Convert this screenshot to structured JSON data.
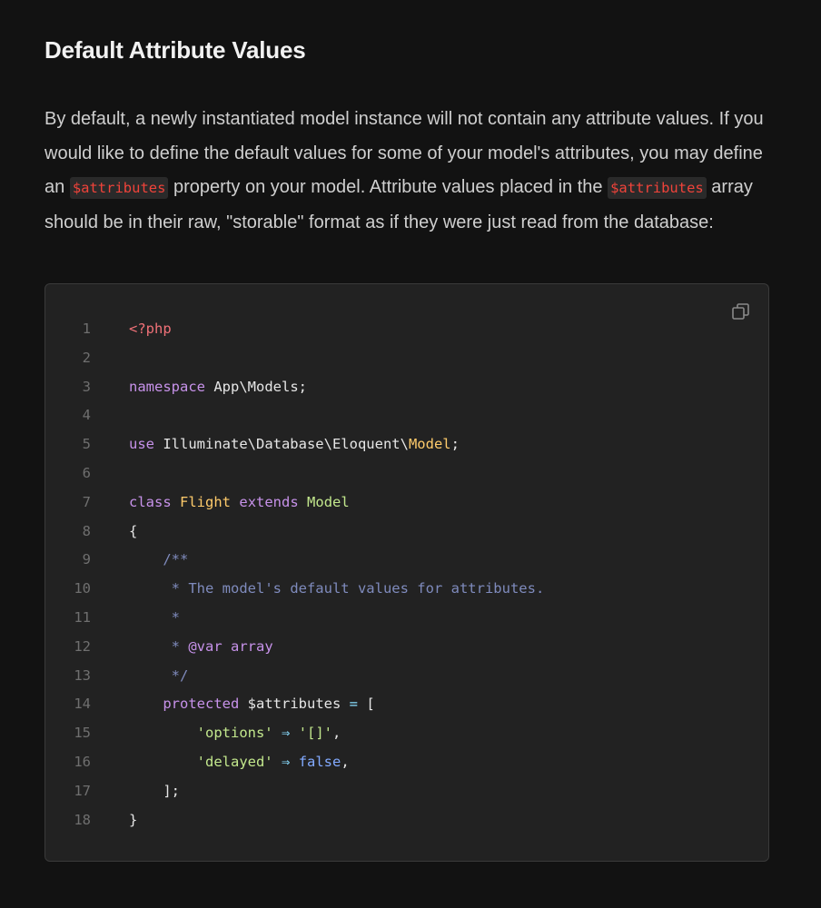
{
  "heading": "Default Attribute Values",
  "paragraph": {
    "part1": "By default, a newly instantiated model instance will not contain any attribute values. If you would like to define the default values for some of your model's attributes, you may define an ",
    "code1": "$attributes",
    "part2": " property on your model. Attribute values placed in the ",
    "code2": "$attributes",
    "part3": " array should be in their raw, \"storable\" format as if they were just read from the database:"
  },
  "copy_button": {
    "icon": "copy-icon"
  },
  "code_lines": [
    {
      "n": "1",
      "tokens": [
        [
          "tag",
          "<?php"
        ]
      ]
    },
    {
      "n": "2",
      "tokens": []
    },
    {
      "n": "3",
      "tokens": [
        [
          "kw",
          "namespace"
        ],
        [
          "plain",
          " App\\Models;"
        ]
      ]
    },
    {
      "n": "4",
      "tokens": []
    },
    {
      "n": "5",
      "tokens": [
        [
          "kw",
          "use"
        ],
        [
          "plain",
          " Illuminate\\Database\\Eloquent\\"
        ],
        [
          "cls",
          "Model"
        ],
        [
          "plain",
          ";"
        ]
      ]
    },
    {
      "n": "6",
      "tokens": []
    },
    {
      "n": "7",
      "tokens": [
        [
          "kw",
          "class"
        ],
        [
          "plain",
          " "
        ],
        [
          "cls",
          "Flight"
        ],
        [
          "plain",
          " "
        ],
        [
          "kw",
          "extends"
        ],
        [
          "plain",
          " "
        ],
        [
          "cls2",
          "Model"
        ]
      ]
    },
    {
      "n": "8",
      "tokens": [
        [
          "plain",
          "{"
        ]
      ]
    },
    {
      "n": "9",
      "tokens": [
        [
          "plain",
          "    "
        ],
        [
          "com",
          "/**"
        ]
      ]
    },
    {
      "n": "10",
      "tokens": [
        [
          "plain",
          "     "
        ],
        [
          "com",
          "* The model's default values for attributes."
        ]
      ]
    },
    {
      "n": "11",
      "tokens": [
        [
          "plain",
          "     "
        ],
        [
          "com",
          "*"
        ]
      ]
    },
    {
      "n": "12",
      "tokens": [
        [
          "plain",
          "     "
        ],
        [
          "com",
          "* "
        ],
        [
          "doctag",
          "@var"
        ],
        [
          "plain",
          " "
        ],
        [
          "kw",
          "array"
        ]
      ]
    },
    {
      "n": "13",
      "tokens": [
        [
          "plain",
          "     "
        ],
        [
          "com",
          "*/"
        ]
      ]
    },
    {
      "n": "14",
      "tokens": [
        [
          "plain",
          "    "
        ],
        [
          "kw",
          "protected"
        ],
        [
          "plain",
          " $attributes "
        ],
        [
          "op",
          "="
        ],
        [
          "plain",
          " ["
        ]
      ]
    },
    {
      "n": "15",
      "tokens": [
        [
          "plain",
          "        "
        ],
        [
          "str",
          "'options'"
        ],
        [
          "plain",
          " "
        ],
        [
          "op",
          "⇒"
        ],
        [
          "plain",
          " "
        ],
        [
          "str",
          "'[]'"
        ],
        [
          "plain",
          ","
        ]
      ]
    },
    {
      "n": "16",
      "tokens": [
        [
          "plain",
          "        "
        ],
        [
          "str",
          "'delayed'"
        ],
        [
          "plain",
          " "
        ],
        [
          "op",
          "⇒"
        ],
        [
          "plain",
          " "
        ],
        [
          "lit",
          "false"
        ],
        [
          "plain",
          ","
        ]
      ]
    },
    {
      "n": "17",
      "tokens": [
        [
          "plain",
          "    ];"
        ]
      ]
    },
    {
      "n": "18",
      "tokens": [
        [
          "plain",
          "}"
        ]
      ]
    }
  ]
}
